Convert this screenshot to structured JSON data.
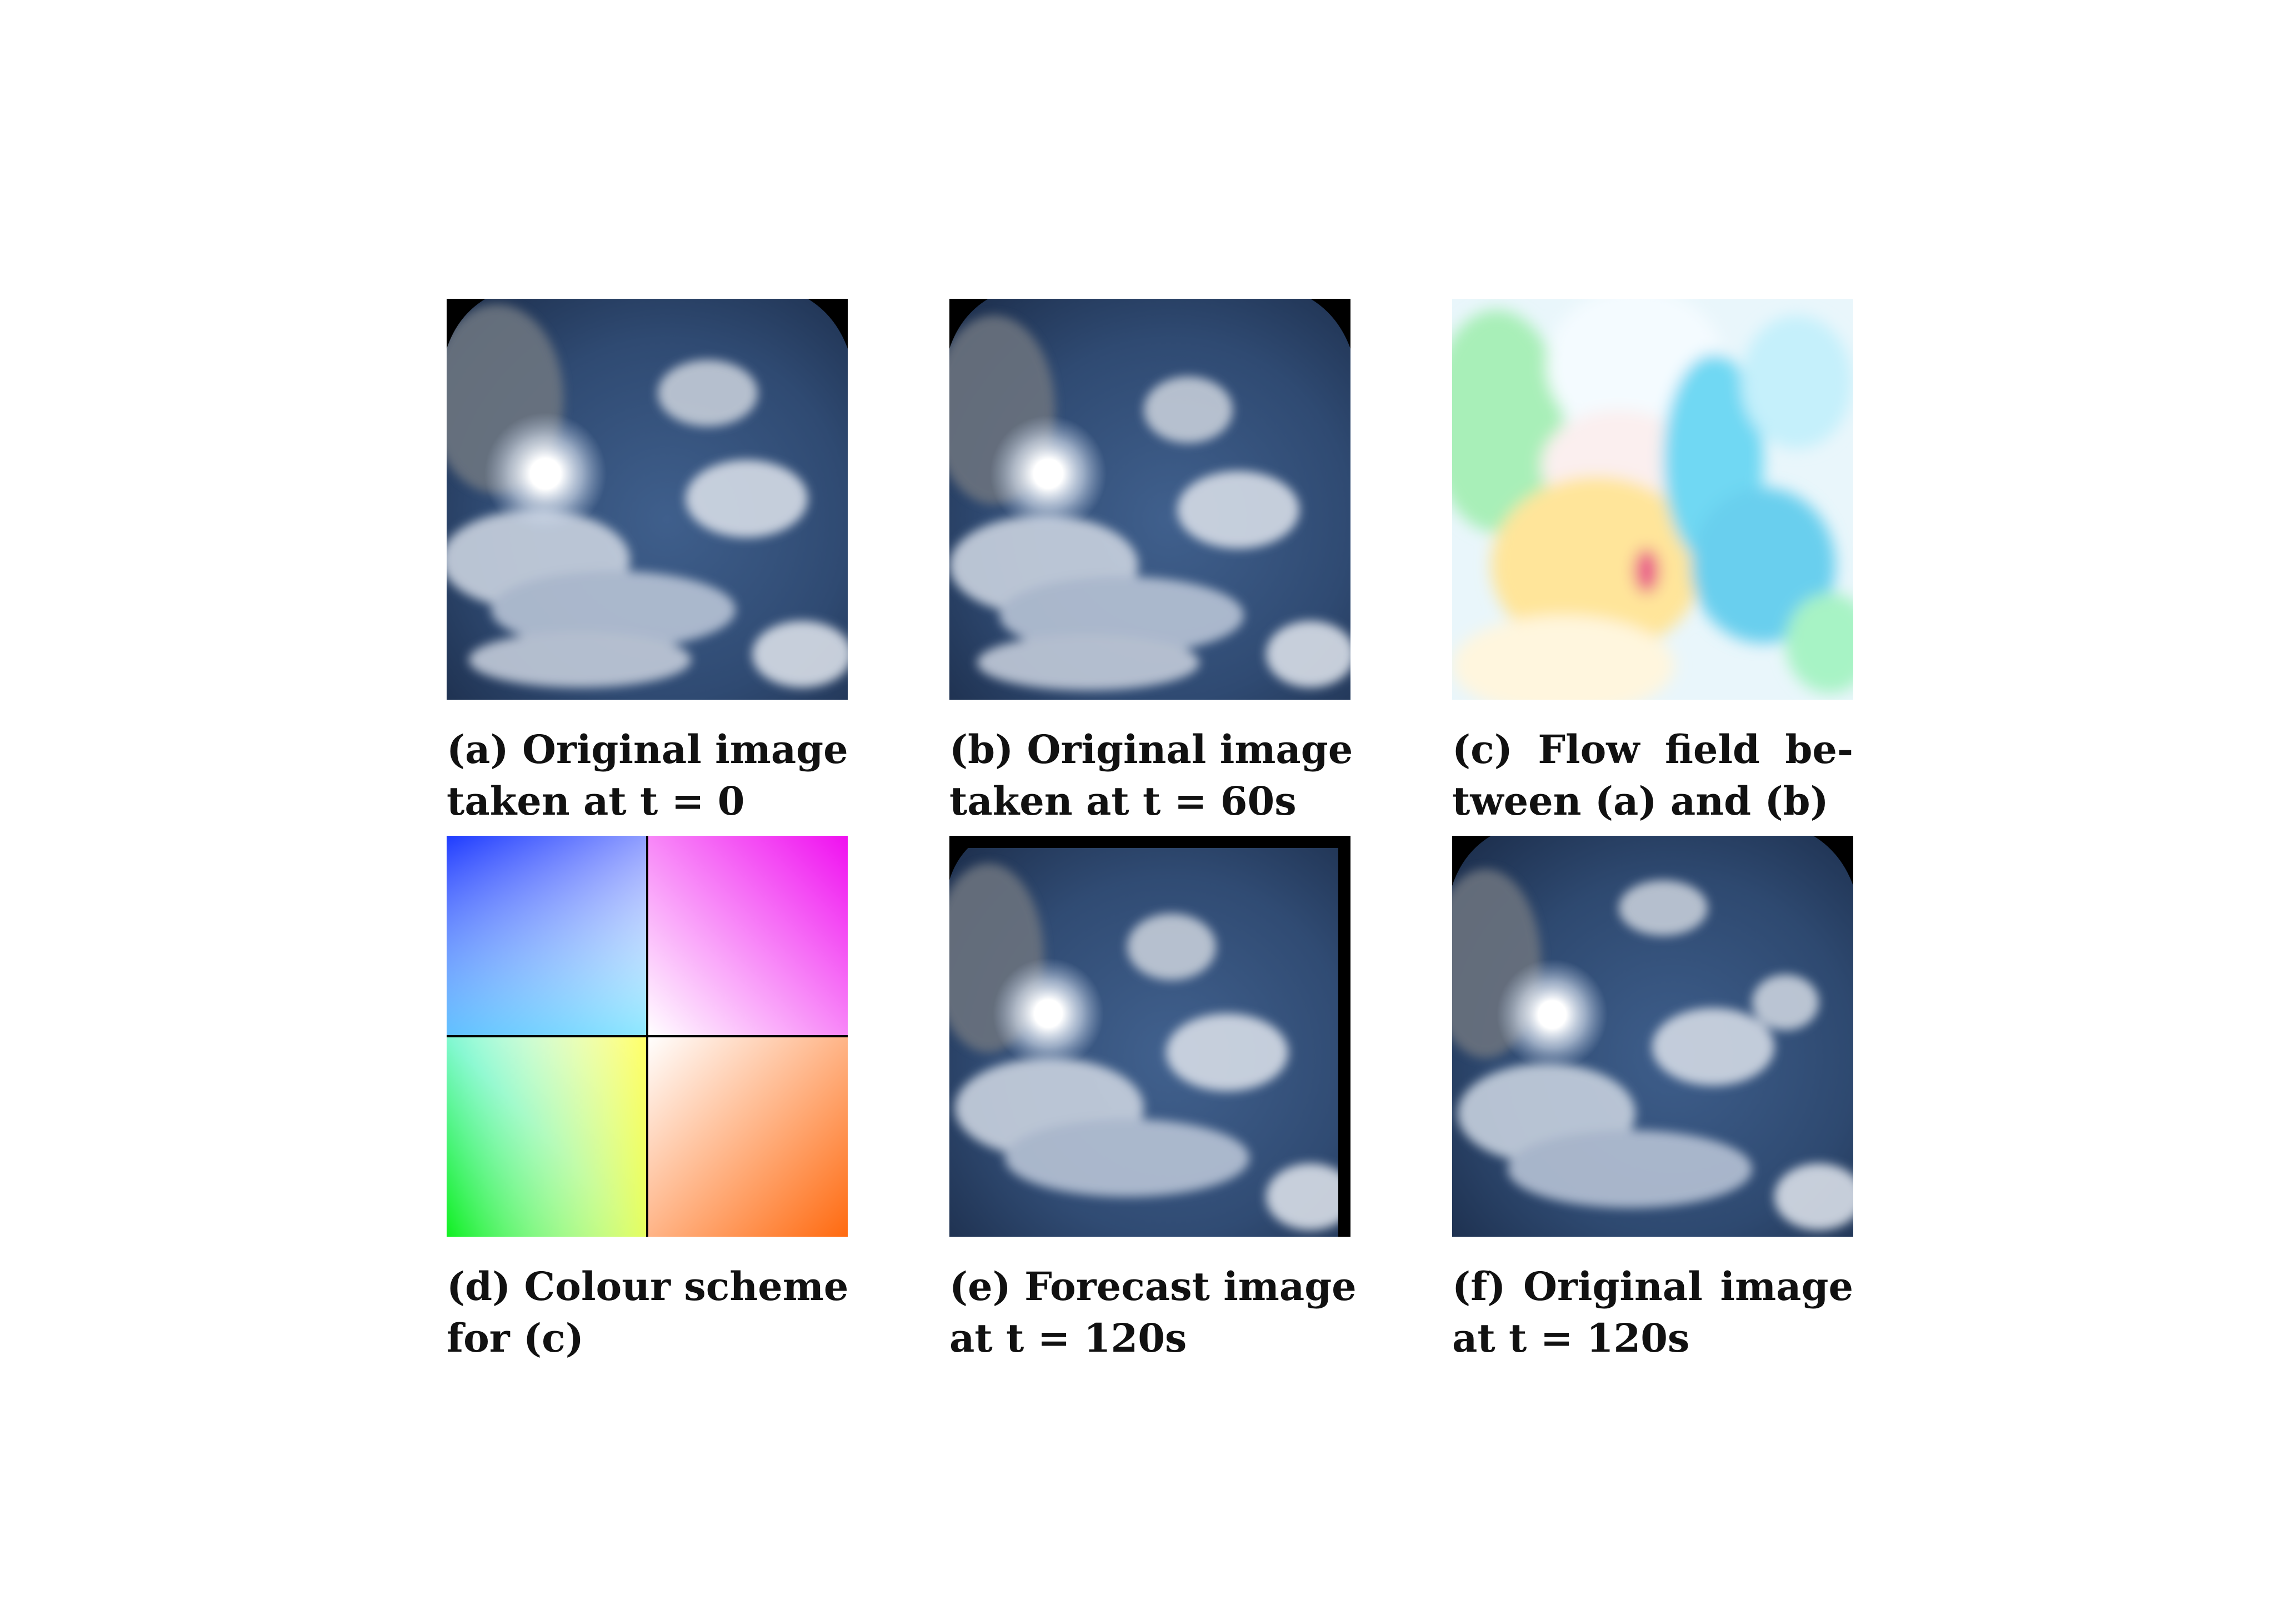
{
  "figure": {
    "panels": [
      {
        "id": "a",
        "kind": "sky-photo",
        "caption_lines": [
          "(a) Original image",
          "taken at t = 0"
        ]
      },
      {
        "id": "b",
        "kind": "sky-photo",
        "caption_lines": [
          "(b) Original image",
          "taken at t = 60s"
        ]
      },
      {
        "id": "c",
        "kind": "flow-field",
        "caption_lines": [
          "(c) Flow field be-",
          "tween (a) and (b)"
        ]
      },
      {
        "id": "d",
        "kind": "colour-wheel",
        "caption_lines": [
          "(d) Colour scheme",
          "for (c)"
        ]
      },
      {
        "id": "e",
        "kind": "sky-photo-warped",
        "caption_lines": [
          "(e) Forecast image",
          "at t = 120s"
        ]
      },
      {
        "id": "f",
        "kind": "sky-photo",
        "caption_lines": [
          "(f) Original image",
          "at t = 120s"
        ]
      }
    ]
  }
}
